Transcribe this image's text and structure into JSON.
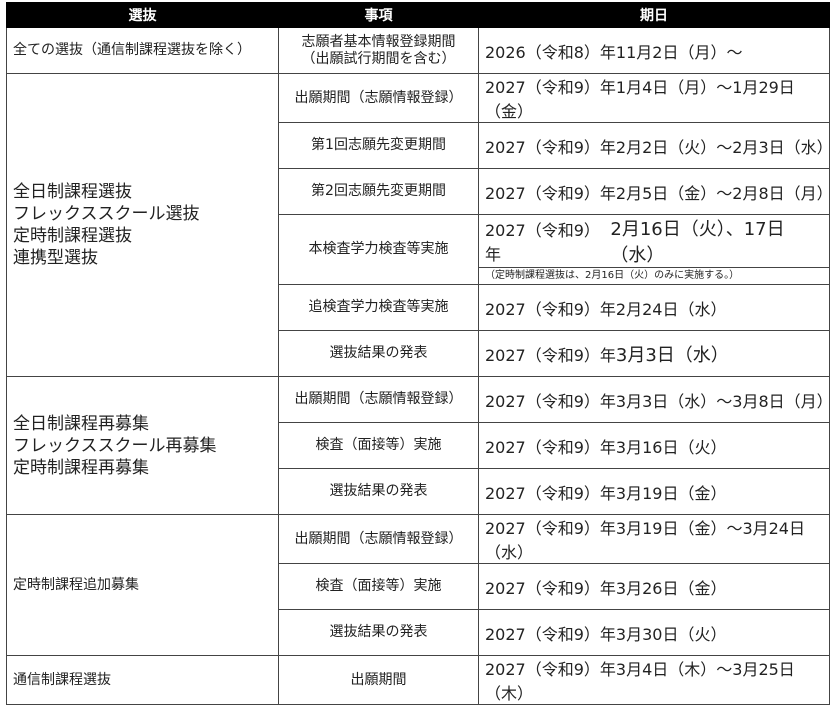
{
  "header": {
    "col_selection": "選抜",
    "col_item": "事項",
    "col_date": "期日"
  },
  "table1": {
    "group1": {
      "selection": "全ての選抜（通信制課程選抜を除く）",
      "item_lines": [
        "志願者基本情報登録期間",
        "（出願試行期間を含む）"
      ],
      "date": "2026（令和8）年11月2日（月）～"
    },
    "group2": {
      "selection_lines": [
        "全日制課程選抜",
        "フレックススクール選抜",
        "定時制課程選抜",
        "連携型選抜"
      ],
      "rows": [
        {
          "item": "出願期間（志願情報登録）",
          "date": "2027（令和9）年1月4日（月）～1月29日（金）"
        },
        {
          "item": "第1回志願先変更期間",
          "date": "2027（令和9）年2月2日（火）～2月3日（水）"
        },
        {
          "item": "第2回志願先変更期間",
          "date": "2027（令和9）年2月5日（金）～2月8日（月）"
        },
        {
          "item": "本検査学力検査等実施",
          "date_prefix": "2027（令和9）年",
          "date_emph": "2月16日（火）、17日（水）",
          "note": "（定時制課程選抜は、2月16日（火）のみに実施する。）"
        },
        {
          "item": "追検査学力検査等実施",
          "date": "2027（令和9）年2月24日（水）"
        },
        {
          "item": "選抜結果の発表",
          "date_prefix": "2027（令和9）年",
          "date_emph": "3月3日（水）"
        }
      ]
    }
  },
  "table2": {
    "group1": {
      "selection_lines": [
        "全日制課程再募集",
        "フレックススクール再募集",
        "定時制課程再募集"
      ],
      "rows": [
        {
          "item": "出願期間（志願情報登録）",
          "date": "2027（令和9）年3月3日（水）～3月8日（月）"
        },
        {
          "item": "検査（面接等）実施",
          "date": "2027（令和9）年3月16日（火）"
        },
        {
          "item": "選抜結果の発表",
          "date": "2027（令和9）年3月19日（金）"
        }
      ]
    },
    "group2": {
      "selection": "定時制課程追加募集",
      "rows": [
        {
          "item": "出願期間（志願情報登録）",
          "date": "2027（令和9）年3月19日（金）～3月24日（水）"
        },
        {
          "item": "検査（面接等）実施",
          "date": "2027（令和9）年3月26日（金）"
        },
        {
          "item": "選抜結果の発表",
          "date": "2027（令和9）年3月30日（火）"
        }
      ]
    },
    "group3": {
      "selection": "通信制課程選抜",
      "rows": [
        {
          "item": "出願期間",
          "date": "2027（令和9）年3月4日（木）～3月25日（木）"
        }
      ]
    }
  }
}
